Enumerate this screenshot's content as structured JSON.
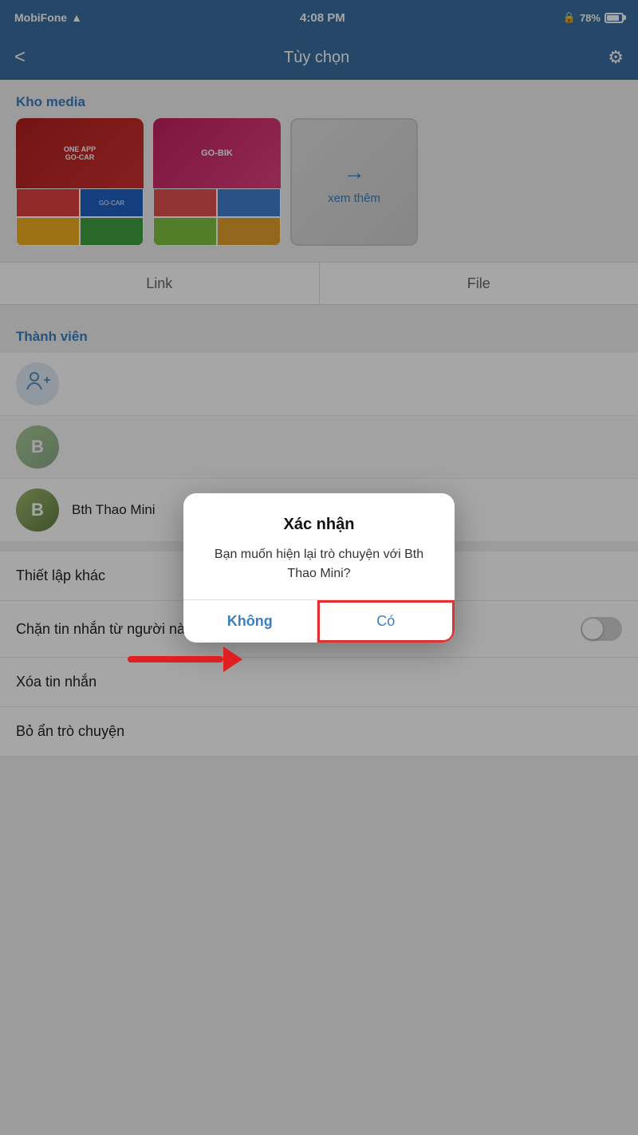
{
  "statusBar": {
    "carrier": "MobiFone",
    "wifi": true,
    "time": "4:08 PM",
    "lock": true,
    "battery": "78%"
  },
  "navBar": {
    "backLabel": "<",
    "title": "Tùy chọn",
    "settingsIcon": "⚙"
  },
  "sections": {
    "media": {
      "header": "Kho media",
      "viewMoreLabel": "xem thêm"
    },
    "tabs": [
      {
        "label": "Link"
      },
      {
        "label": "File"
      }
    ],
    "members": {
      "header": "Thành viên",
      "memberName": "Bth Thao Mini"
    },
    "settings": [
      {
        "label": "Thiết lập khác"
      },
      {
        "label": "Chặn tin nhắn từ người này",
        "hasToggle": true
      },
      {
        "label": "Xóa tin nhắn"
      },
      {
        "label": "Bỏ ẩn trò chuyện"
      }
    ]
  },
  "dialog": {
    "title": "Xác nhận",
    "message": "Bạn muốn hiện lại trò chuyện với Bth Thao Mini?",
    "buttonNo": "Không",
    "buttonYes": "Có"
  }
}
